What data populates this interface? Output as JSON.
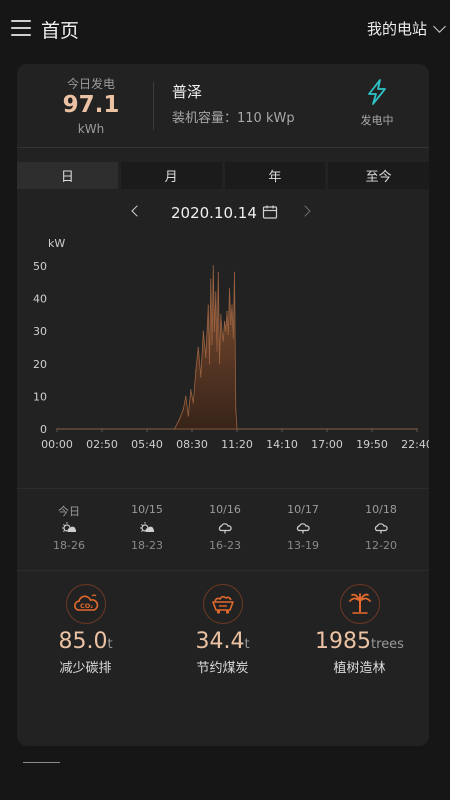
{
  "header": {
    "title": "首页",
    "station_selector": "我的电站"
  },
  "summary": {
    "today_label": "今日发电",
    "today_value": "97.1",
    "today_unit": "kWh",
    "station_name": "普泽",
    "capacity": "装机容量：110 kWp",
    "status": "发电中",
    "status_icon": "lightning-icon",
    "accent": "#ebc2a3",
    "status_color": "#2ec4c7"
  },
  "tabs": [
    {
      "label": "日",
      "active": true
    },
    {
      "label": "月",
      "active": false
    },
    {
      "label": "年",
      "active": false
    },
    {
      "label": "至今",
      "active": false
    }
  ],
  "date_nav": {
    "date": "2020.10.14"
  },
  "chart_data": {
    "type": "area",
    "ylabel": "kW",
    "ylim": [
      0,
      50
    ],
    "yticks": [
      0,
      10,
      20,
      30,
      40,
      50
    ],
    "xticks": [
      "00:00",
      "02:50",
      "05:40",
      "08:30",
      "11:20",
      "14:10",
      "17:00",
      "19:50",
      "22:40"
    ],
    "x_minutes": [
      0,
      470,
      490,
      505,
      515,
      525,
      535,
      545,
      555,
      565,
      575,
      585,
      595,
      605,
      610,
      615,
      620,
      625,
      630,
      635,
      640,
      645,
      650,
      655,
      660,
      665,
      670,
      675,
      680,
      685,
      690,
      695,
      700,
      705,
      710,
      715,
      720,
      1440
    ],
    "values": [
      0,
      0,
      3,
      6,
      10,
      4,
      12,
      8,
      18,
      25,
      16,
      30,
      22,
      38,
      20,
      46,
      26,
      50,
      30,
      42,
      24,
      48,
      20,
      35,
      30,
      27,
      33,
      30,
      36,
      29,
      43,
      32,
      38,
      28,
      48,
      6,
      0,
      0
    ],
    "fill_color": "#7a4a30"
  },
  "weather": [
    {
      "date": "今日",
      "icon": "sunny-cloudy-icon",
      "temp": "18-26"
    },
    {
      "date": "10/15",
      "icon": "sunny-cloudy-icon",
      "temp": "18-23"
    },
    {
      "date": "10/16",
      "icon": "cloudy-icon",
      "temp": "16-23"
    },
    {
      "date": "10/17",
      "icon": "cloudy-icon",
      "temp": "13-19"
    },
    {
      "date": "10/18",
      "icon": "cloudy-icon",
      "temp": "12-20"
    }
  ],
  "eco": [
    {
      "value": "85.0",
      "unit": "t",
      "label": "减少碳排",
      "icon": "co2-cloud-icon"
    },
    {
      "value": "34.4",
      "unit": "t",
      "label": "节约煤炭",
      "icon": "coal-cart-icon"
    },
    {
      "value": "1985",
      "unit": "trees",
      "label": "植树造林",
      "icon": "palm-tree-icon"
    }
  ]
}
